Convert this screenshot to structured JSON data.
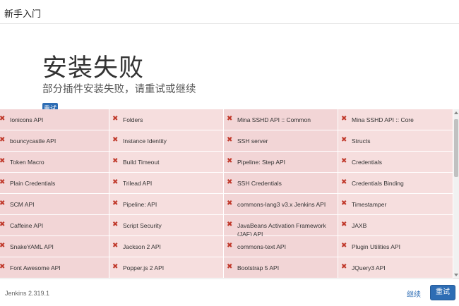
{
  "header": {
    "title": "新手入门"
  },
  "hero": {
    "title": "安装失败",
    "subtitle": "部分插件安装失败，请重试或继续",
    "retry_label": "重试"
  },
  "plugins": [
    [
      "Ionicons API",
      "Folders",
      "Mina SSHD API :: Common",
      "Mina SSHD API :: Core"
    ],
    [
      "bouncycastle API",
      "Instance Identity",
      "SSH server",
      "Structs"
    ],
    [
      "Token Macro",
      "Build Timeout",
      "Pipeline: Step API",
      "Credentials"
    ],
    [
      "Plain Credentials",
      "Trilead API",
      "SSH Credentials",
      "Credentials Binding"
    ],
    [
      "SCM API",
      "Pipeline: API",
      "commons-lang3 v3.x Jenkins API",
      "Timestamper"
    ],
    [
      "Caffeine API",
      "Script Security",
      "JavaBeans Activation Framework (JAF) API",
      "JAXB"
    ],
    [
      "SnakeYAML API",
      "Jackson 2 API",
      "commons-text API",
      "Plugin Utilities API"
    ],
    [
      "Font Awesome API",
      "Popper.js 2 API",
      "Bootstrap 5 API",
      "JQuery3 API"
    ]
  ],
  "status_icon": "close-x-icon",
  "colors": {
    "failed_bg": "#f2d5d6",
    "failed_icon": "#c0392b",
    "primary": "#2e6db4"
  },
  "footer": {
    "version": "Jenkins 2.319.1",
    "continue_label": "继续",
    "retry_label": "重试"
  }
}
